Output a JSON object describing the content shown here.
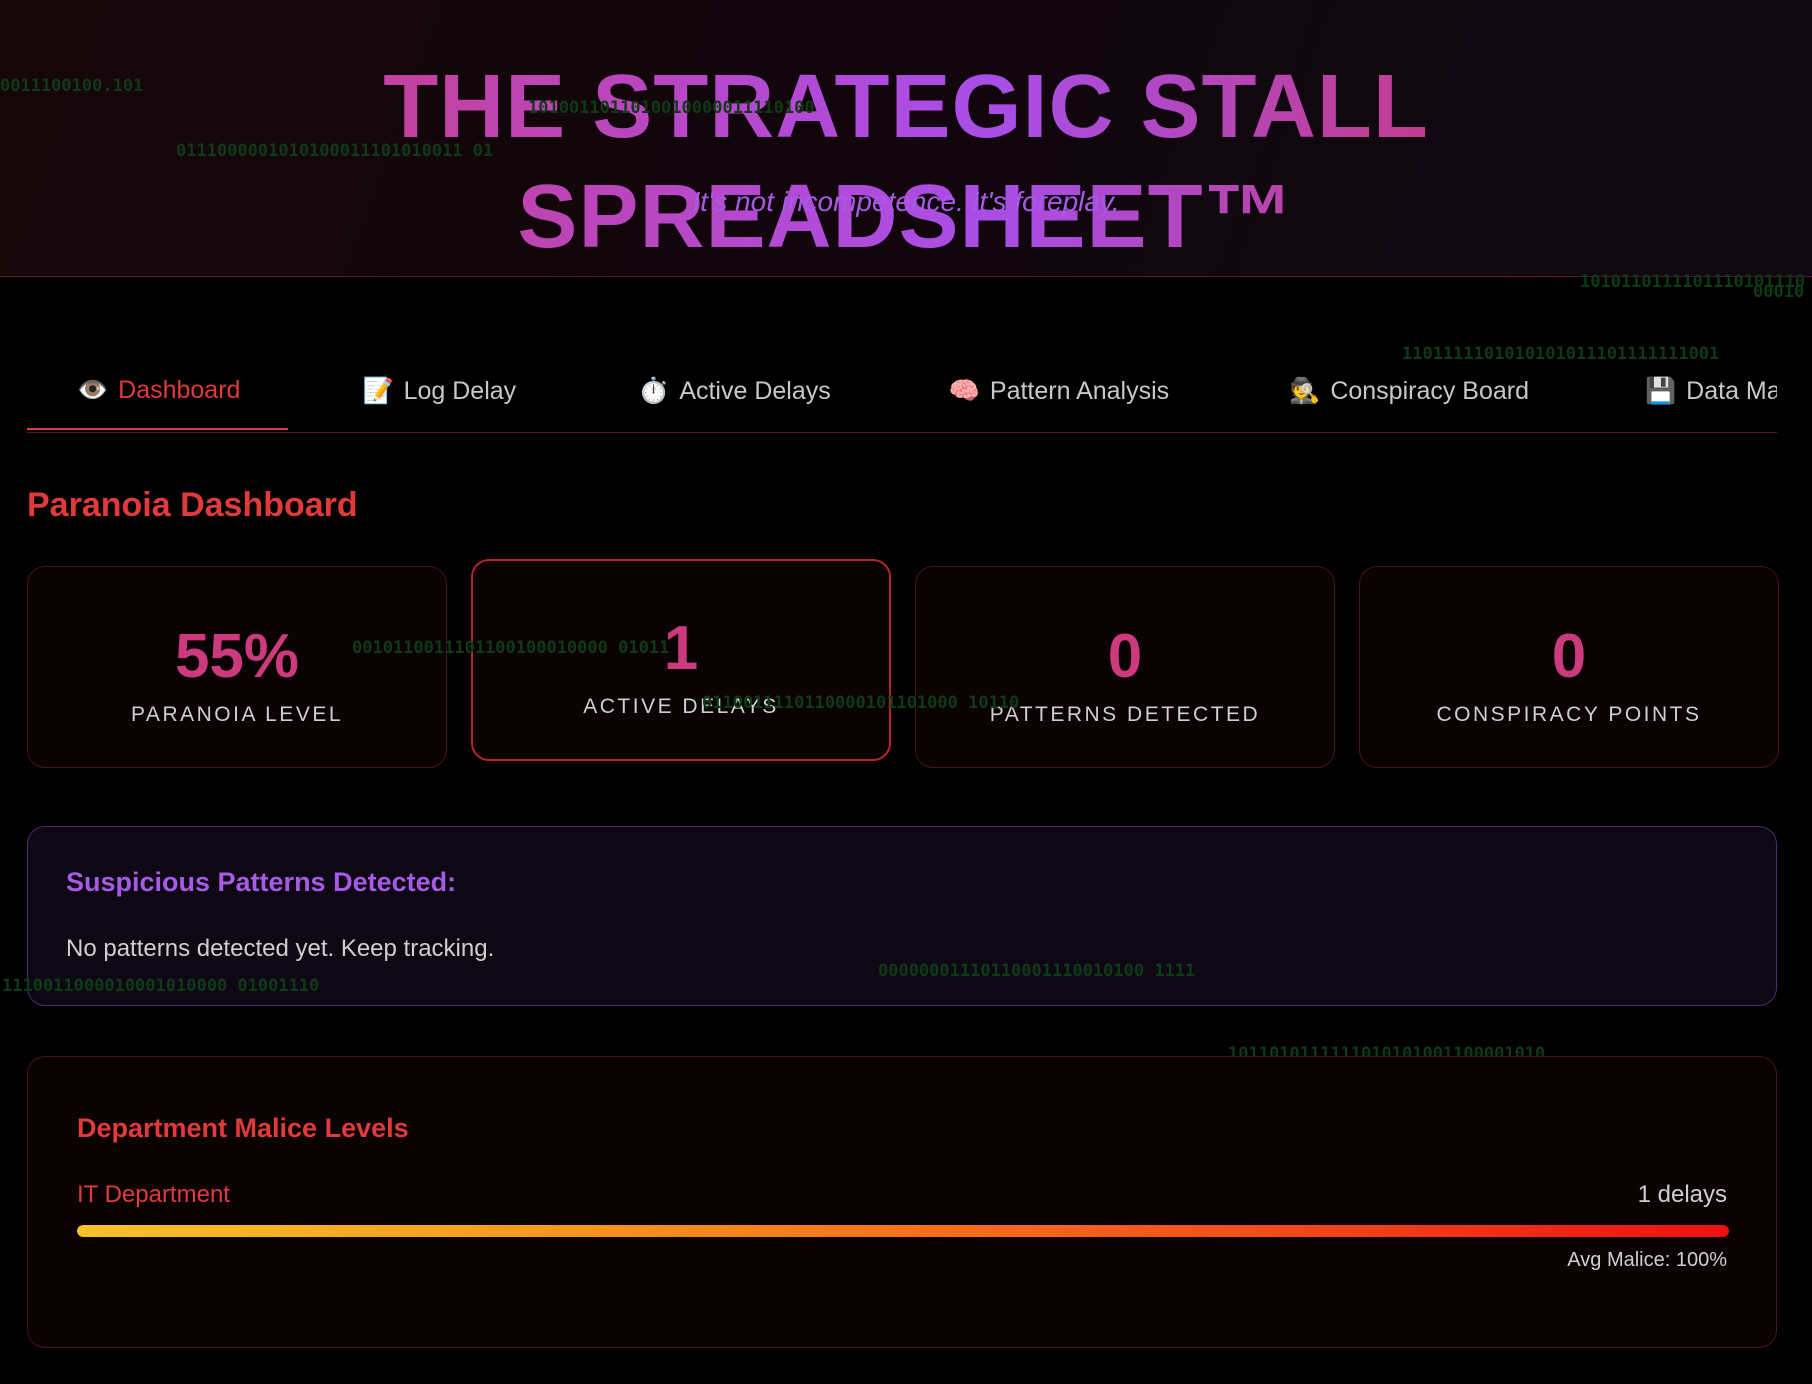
{
  "header": {
    "title": "THE STRATEGIC STALL SPREADSHEET™",
    "subtitle": "It's not incompetence. It's foreplay."
  },
  "tabs": [
    {
      "icon": "👁️",
      "icon_name": "eye-icon",
      "label": "Dashboard",
      "active": true
    },
    {
      "icon": "📝",
      "icon_name": "memo-icon",
      "label": "Log Delay",
      "active": false
    },
    {
      "icon": "⏱️",
      "icon_name": "stopwatch-icon",
      "label": "Active Delays",
      "active": false
    },
    {
      "icon": "🧠",
      "icon_name": "brain-icon",
      "label": "Pattern Analysis",
      "active": false
    },
    {
      "icon": "🕵️",
      "icon_name": "detective-icon",
      "label": "Conspiracy Board",
      "active": false
    },
    {
      "icon": "💾",
      "icon_name": "floppy-disk-icon",
      "label": "Data Ma",
      "active": false
    }
  ],
  "dashboard": {
    "title": "Paranoia Dashboard",
    "stats": [
      {
        "value": "55%",
        "label": "PARANOIA LEVEL"
      },
      {
        "value": "1",
        "label": "ACTIVE DELAYS"
      },
      {
        "value": "0",
        "label": "PATTERNS DETECTED"
      },
      {
        "value": "0",
        "label": "CONSPIRACY POINTS"
      }
    ]
  },
  "patterns": {
    "title": "Suspicious Patterns Detected:",
    "message": "No patterns detected yet. Keep tracking."
  },
  "malice": {
    "title": "Department Malice Levels",
    "departments": [
      {
        "name": "IT Department",
        "count": "1 delays",
        "avg": "Avg Malice: 100%",
        "level": 1.0
      }
    ]
  },
  "background_binary": [
    "0011100100.101",
    "1010011011010010000011110100",
    "0111000001010100011101010011 01",
    "1010110111101110101110",
    "00010",
    "1101111101010101011101111111001",
    "0010110011101100100010000 01011",
    "0110011110110000101101000 10110",
    "00000001110110001110010100 1111",
    "1110011000010001010000 01001110",
    "1011010111111010101001100001010"
  ],
  "colors": {
    "accent_red": "#e03a3a",
    "accent_purple": "#a65ae6",
    "stat_pink": "#cc3a7e",
    "card_border": "#4a1219"
  }
}
